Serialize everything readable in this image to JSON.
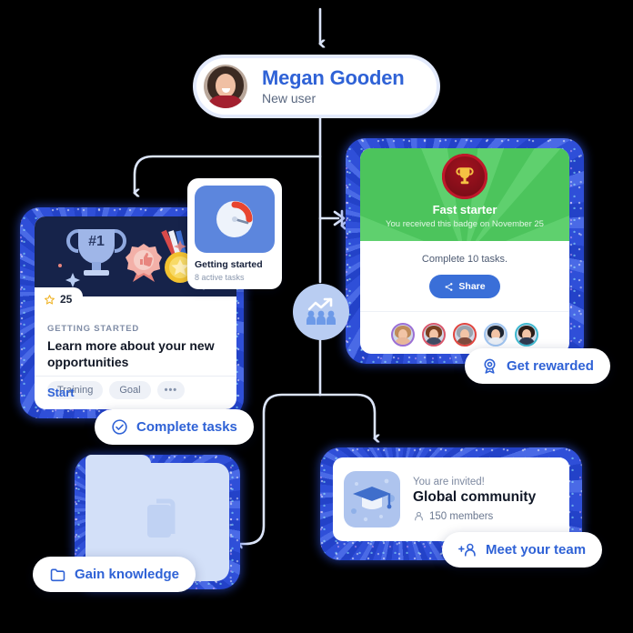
{
  "user": {
    "name": "Megan Gooden",
    "role": "New user",
    "avatar_icon": "user-photo-avatar"
  },
  "hub": {
    "icon": "growth-community-icon"
  },
  "getting_started_widget": {
    "title": "Getting started",
    "subtitle": "8 active tasks",
    "icon": "speedometer-gauge-icon"
  },
  "task_card": {
    "points": "25",
    "points_icon": "star-icon",
    "eyebrow": "GETTING STARTED",
    "title": "Learn more about your new opportunities",
    "tags": [
      "Training",
      "Goal"
    ],
    "more_label": "•••",
    "action": "Start",
    "hero_icons": [
      "trophy-number-one-icon",
      "thumbs-up-rosette-icon",
      "gold-star-medal-icon"
    ]
  },
  "badge_card": {
    "title": "Fast starter",
    "subtitle": "You received this badge on November 25",
    "description": "Complete 10 tasks.",
    "share_label": "Share",
    "share_icon": "share-icon",
    "medal_icon": "trophy-icon",
    "avatars": [
      {
        "ring": "#9b6fd4",
        "hair": "#c08b5a",
        "shirt": "#e8b79a"
      },
      {
        "ring": "#d9566a",
        "hair": "#7a3f20",
        "shirt": "#3f4a63"
      },
      {
        "ring": "#e0453f",
        "hair": "#9aa3ae",
        "shirt": "#7f4a3c"
      },
      {
        "ring": "#9fc4f0",
        "hair": "#1d2430",
        "shirt": "#e9eef5"
      },
      {
        "ring": "#3fb8cf",
        "hair": "#2a1c16",
        "shirt": "#2f3a50"
      }
    ]
  },
  "community_card": {
    "eyebrow": "You are invited!",
    "title": "Global community",
    "members": "150 members",
    "members_icon": "person-icon",
    "icon": "graduation-cap-icon"
  },
  "folder_card": {
    "icon": "folder-documents-icon"
  },
  "pills": [
    {
      "label": "Complete tasks",
      "icon": "check-circle-icon"
    },
    {
      "label": "Gain knowledge",
      "icon": "folder-icon"
    },
    {
      "label": "Get rewarded",
      "icon": "award-ribbon-icon"
    },
    {
      "label": "Meet your team",
      "icon": "add-person-icon"
    }
  ],
  "colors": {
    "accent_blue": "#2f62d6",
    "glow_blue": "#2a49d2",
    "badge_green": "#4cc45c",
    "dark_navy": "#16234a",
    "connector": "#dbe4f8",
    "light_blue": "#b9cdf2"
  }
}
